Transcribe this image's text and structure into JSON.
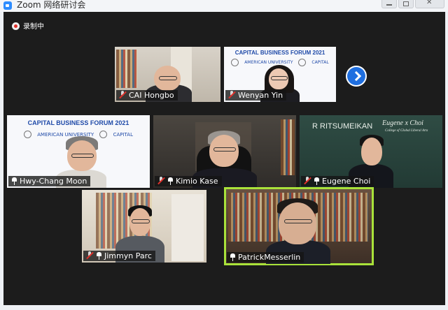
{
  "window": {
    "title": "Zoom 网络研讨会"
  },
  "recording": {
    "label": "录制中"
  },
  "banner": {
    "title": "CAPITAL BUSINESS FORUM 2021",
    "logos": [
      "AMERICAN UNIVERSITY",
      "CAPITAL"
    ]
  },
  "backgrounds": {
    "ritsumeikan": "R RITSUMEIKAN",
    "signature": "Eugene x Choi",
    "signature_sub": "College of Global Liberal Arts"
  },
  "participants": [
    {
      "name": "CAI Hongbo",
      "muted": true,
      "pinned": false
    },
    {
      "name": "Wenyan Yin",
      "muted": true,
      "pinned": false
    },
    {
      "name": "Hwy-Chang Moon",
      "muted": false,
      "pinned": true
    },
    {
      "name": "Kimio Kase",
      "muted": true,
      "pinned": true
    },
    {
      "name": "Eugene Choi",
      "muted": true,
      "pinned": true
    },
    {
      "name": "Jimmyn Parc",
      "muted": true,
      "pinned": true
    },
    {
      "name": "PatrickMesserlin",
      "muted": false,
      "pinned": true,
      "active_speaker": true
    }
  ],
  "colors": {
    "stage": "#1c1c1c",
    "active_border": "#a9e23a",
    "muted_red": "#e0302a",
    "accent_blue": "#1f6fe0"
  },
  "icons": [
    "zoom-app-icon",
    "record-icon",
    "mic-muted-icon",
    "mic-icon",
    "pin-icon",
    "next-page-arrow-icon"
  ]
}
